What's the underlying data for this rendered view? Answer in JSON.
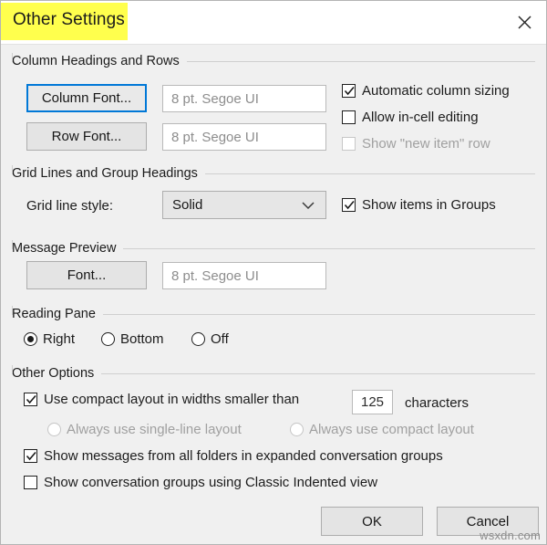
{
  "window": {
    "title": "Other Settings",
    "title_highlight_color": "#ffff4d",
    "close_icon": "close-icon",
    "background": "#f0f0f0",
    "accent": "#0078d7"
  },
  "sections": {
    "column_headings": {
      "heading": "Column Headings and Rows",
      "column_font_button": "Column Font...",
      "column_font_value": "8 pt. Segoe UI",
      "row_font_button": "Row Font...",
      "row_font_value": "8 pt. Segoe UI",
      "checkboxes": [
        {
          "label": "Automatic column sizing",
          "checked": true,
          "enabled": true
        },
        {
          "label": "Allow in-cell editing",
          "checked": false,
          "enabled": true
        },
        {
          "label": "Show \"new item\" row",
          "checked": false,
          "enabled": false
        }
      ]
    },
    "grid_lines": {
      "heading": "Grid Lines and Group Headings",
      "grid_line_style_label": "Grid line style:",
      "grid_line_style_value": "Solid",
      "grid_line_style_options": [
        "Solid"
      ],
      "show_items_in_groups": {
        "label": "Show items in Groups",
        "checked": true,
        "enabled": true
      }
    },
    "message_preview": {
      "heading": "Message Preview",
      "font_button": "Font...",
      "font_value": "8 pt. Segoe UI"
    },
    "reading_pane": {
      "heading": "Reading Pane",
      "options": [
        {
          "label": "Right",
          "selected": true
        },
        {
          "label": "Bottom",
          "selected": false
        },
        {
          "label": "Off",
          "selected": false
        }
      ]
    },
    "other_options": {
      "heading": "Other Options",
      "compact_layout": {
        "label_before": "Use compact layout in widths smaller than",
        "value": "125",
        "label_after": "characters",
        "checked": true,
        "enabled": true
      },
      "layout_radios": [
        {
          "label": "Always use single-line layout",
          "selected": false,
          "enabled": false
        },
        {
          "label": "Always use compact layout",
          "selected": false,
          "enabled": false
        }
      ],
      "show_messages_all_folders": {
        "label": "Show messages from all folders in expanded conversation groups",
        "checked": true,
        "enabled": true
      },
      "classic_indented": {
        "label": "Show conversation groups using Classic Indented view",
        "checked": false,
        "enabled": true
      }
    }
  },
  "footer": {
    "ok_label": "OK",
    "cancel_label": "Cancel"
  },
  "watermark": "wsxdn.com"
}
